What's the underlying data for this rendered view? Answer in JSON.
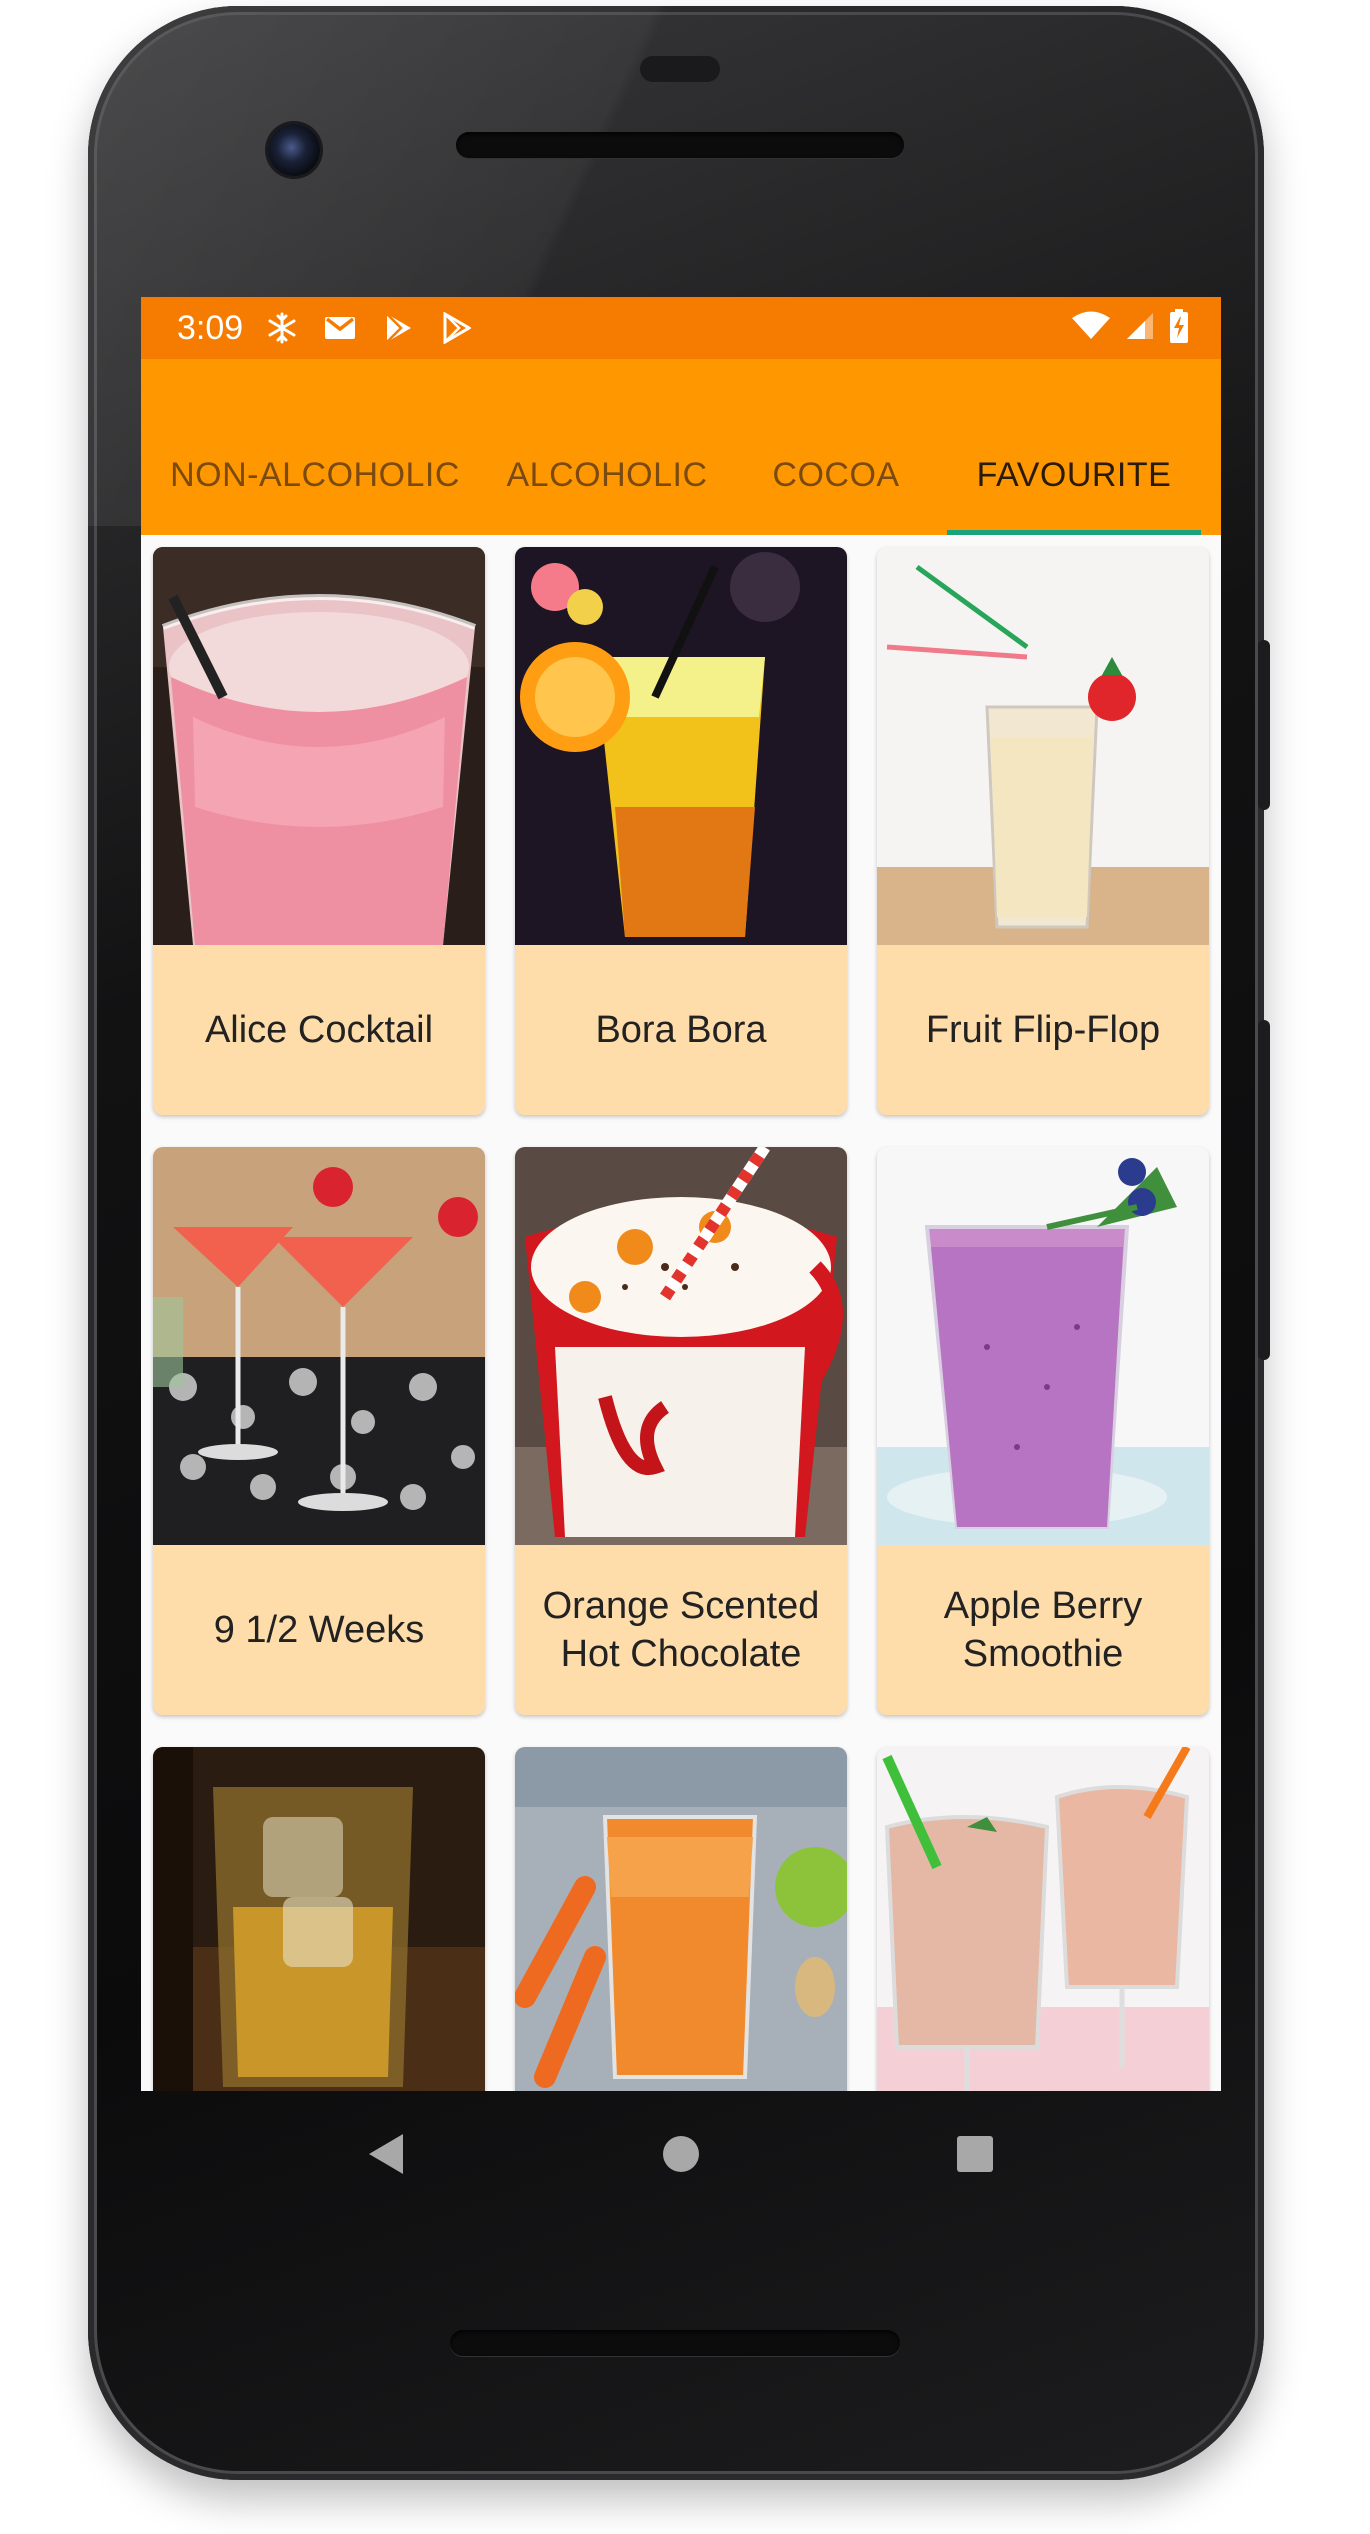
{
  "status_bar": {
    "time": "3:09",
    "left_icons": [
      "snowflake-icon",
      "gmail-icon",
      "play-store-icon",
      "play-store-icon"
    ],
    "right_icons": [
      "wifi-icon",
      "cellular-signal-icon",
      "battery-charging-icon"
    ],
    "background_color": "#f57c00"
  },
  "app_bar": {
    "background_color": "#ff9800",
    "tabs": [
      {
        "label": "NON-ALCOHOLIC",
        "active": false
      },
      {
        "label": "ALCOHOLIC",
        "active": false
      },
      {
        "label": "COCOA",
        "active": false
      },
      {
        "label": "FAVOURITE",
        "active": true
      }
    ],
    "indicator_color": "#1aa37a"
  },
  "drinks": [
    {
      "name": "Alice Cocktail"
    },
    {
      "name": "Bora Bora"
    },
    {
      "name": "Fruit Flip-Flop"
    },
    {
      "name": "9 1/2 Weeks"
    },
    {
      "name": "Orange Scented Hot Chocolate"
    },
    {
      "name": "Apple Berry Smoothie"
    },
    {
      "name": ""
    },
    {
      "name": ""
    },
    {
      "name": ""
    }
  ],
  "card_label_background": "#ffddaa",
  "nav_bar": {
    "buttons": [
      "back-icon",
      "home-icon",
      "recents-icon"
    ]
  }
}
